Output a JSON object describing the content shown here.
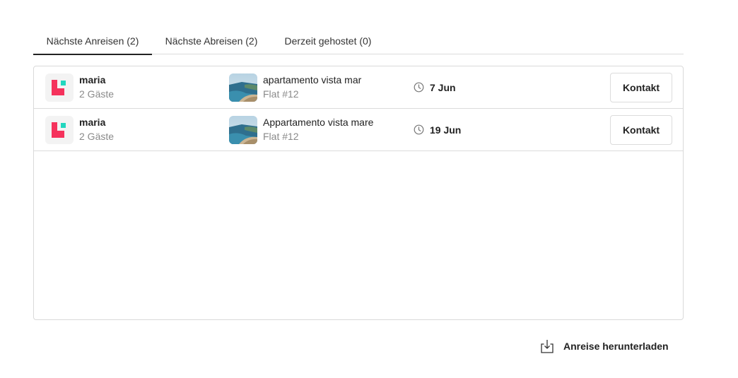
{
  "tabs": [
    {
      "label": "Nächste Anreisen (2)",
      "active": true
    },
    {
      "label": "Nächste Abreisen (2)",
      "active": false
    },
    {
      "label": "Derzeit gehostet (0)",
      "active": false
    }
  ],
  "rows": [
    {
      "guest": "maria",
      "guests_count": "2 Gäste",
      "property": "apartamento vista mar",
      "unit": "Flat #12",
      "date": "7 Jun",
      "contact_label": "Kontakt"
    },
    {
      "guest": "maria",
      "guests_count": "2 Gäste",
      "property": "Appartamento vista mare",
      "unit": "Flat #12",
      "date": "19 Jun",
      "contact_label": "Kontakt"
    }
  ],
  "download": {
    "label": "Anreise herunterladen"
  },
  "icons": {
    "avatar": "logo-icon",
    "clock": "clock-icon",
    "download": "download-icon"
  },
  "colors": {
    "logo_red": "#f5325c",
    "logo_teal": "#22d7bf",
    "text": "#222222",
    "muted": "#8a8a8a",
    "border": "#dcdcdc"
  }
}
